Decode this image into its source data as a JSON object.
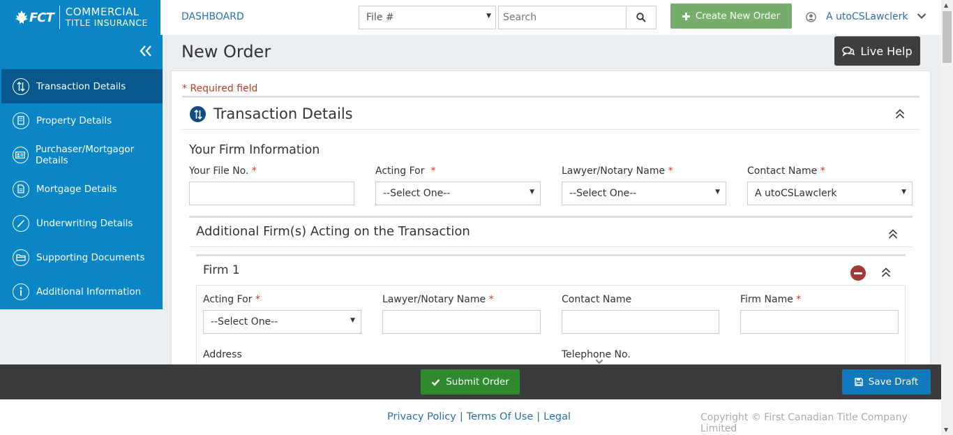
{
  "brand": {
    "logo_mark": "FCT",
    "line1": "COMMERCIAL",
    "line2": "TITLE INSURANCE"
  },
  "header": {
    "dashboard_label": "DASHBOARD",
    "file_select_value": "File #",
    "search_placeholder": "Search",
    "create_label": "Create New Order",
    "user_name": "A utoCSLawclerk"
  },
  "sidebar": {
    "items": [
      {
        "label": "Transaction Details",
        "icon": "arrows-updown-icon",
        "active": true
      },
      {
        "label": "Property Details",
        "icon": "building-icon"
      },
      {
        "label": "Purchaser/Mortgagor Details",
        "icon": "id-card-icon"
      },
      {
        "label": "Mortgage Details",
        "icon": "document-icon"
      },
      {
        "label": "Underwriting Details",
        "icon": "pen-icon"
      },
      {
        "label": "Supporting Documents",
        "icon": "folder-icon"
      },
      {
        "label": "Additional Information",
        "icon": "info-icon"
      }
    ]
  },
  "main": {
    "page_title": "New Order",
    "live_help": "Live Help",
    "required_note": "* Required field",
    "section_title": "Transaction Details",
    "firm_info_title": "Your Firm Information",
    "fields": {
      "file_no_label": "Your File No.",
      "acting_for_label": "Acting For",
      "acting_for_value": "--Select One--",
      "lawyer_label": "Lawyer/Notary Name",
      "lawyer_value": "--Select One--",
      "contact_label": "Contact Name",
      "contact_value": "A utoCSLawclerk"
    },
    "additional_title": "Additional Firm(s) Acting on the Transaction",
    "firm1": {
      "title": "Firm 1",
      "acting_for_label": "Acting For",
      "acting_for_value": "--Select One--",
      "lawyer_label": "Lawyer/Notary Name",
      "contact_label": "Contact Name",
      "firm_name_label": "Firm Name",
      "address_label": "Address",
      "telephone_label": "Telephone No."
    }
  },
  "bottombar": {
    "submit_label": "Submit Order",
    "draft_label": "Save Draft"
  },
  "footer": {
    "privacy": "Privacy Policy",
    "terms": "Terms Of Use",
    "legal": "Legal",
    "separator": "|",
    "copyright": "Copyright © First Canadian Title Company Limited"
  },
  "colors": {
    "brand_blue": "#0a86c6",
    "active_nav": "#07578c",
    "create_green": "#77ad6b",
    "submit_green": "#2e8b2e",
    "draft_blue": "#1379bb",
    "required_red": "#c03a2b"
  }
}
